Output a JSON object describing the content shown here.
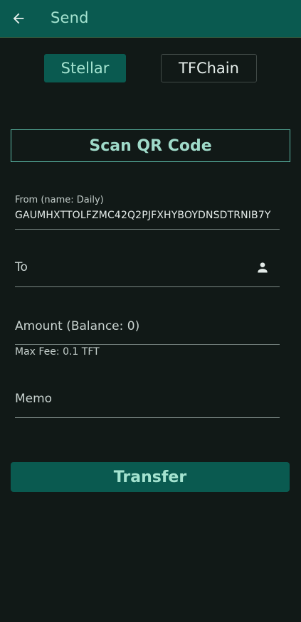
{
  "header": {
    "back_icon": "arrow-left-icon",
    "title": "Send"
  },
  "network_tabs": [
    {
      "label": "Stellar",
      "selected": true
    },
    {
      "label": "TFChain",
      "selected": false
    }
  ],
  "scan_button": {
    "label": "Scan QR Code"
  },
  "from": {
    "label": "From (name: Daily)",
    "value": "GAUMHXTTOLFZMC42Q2PJFXHYBOYDNSDTRNIB7Y"
  },
  "to": {
    "label": "To",
    "icon": "person-icon"
  },
  "amount": {
    "label": "Amount (Balance: 0)"
  },
  "fee": {
    "text": "Max Fee: 0.1 TFT"
  },
  "memo": {
    "label": "Memo"
  },
  "transfer_button": {
    "label": "Transfer"
  },
  "colors": {
    "background": "#111917",
    "primary": "#0a5a50",
    "accent_text": "#a4e3d0",
    "outline": "#5bb9a6"
  }
}
